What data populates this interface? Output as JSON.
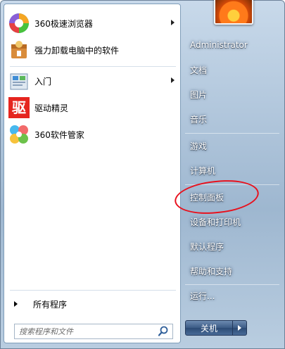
{
  "left_pane": {
    "pinned": [
      {
        "label": "360极速浏览器",
        "icon": "360-browser-icon",
        "has_submenu": true
      },
      {
        "label": "强力卸载电脑中的软件",
        "icon": "uninstall-icon",
        "has_submenu": false
      }
    ],
    "recent": [
      {
        "label": "入门",
        "icon": "getting-started-icon",
        "has_submenu": true
      },
      {
        "label": "驱动精灵",
        "icon": "driver-genius-icon",
        "has_submenu": false
      },
      {
        "label": "360软件管家",
        "icon": "360-software-manager-icon",
        "has_submenu": false
      }
    ],
    "driver_icon_text": "驱",
    "all_programs": "所有程序",
    "search_placeholder": "搜索程序和文件"
  },
  "right_pane": {
    "items": [
      {
        "label": "Administrator"
      },
      {
        "label": "文档"
      },
      {
        "label": "图片"
      },
      {
        "label": "音乐"
      },
      {
        "label": "游戏"
      },
      {
        "label": "计算机"
      },
      {
        "label": "控制面板"
      },
      {
        "label": "设备和打印机"
      },
      {
        "label": "默认程序"
      },
      {
        "label": "帮助和支持"
      },
      {
        "label": "运行..."
      }
    ],
    "shutdown_label": "关机",
    "highlight_color": "#e8111d"
  }
}
